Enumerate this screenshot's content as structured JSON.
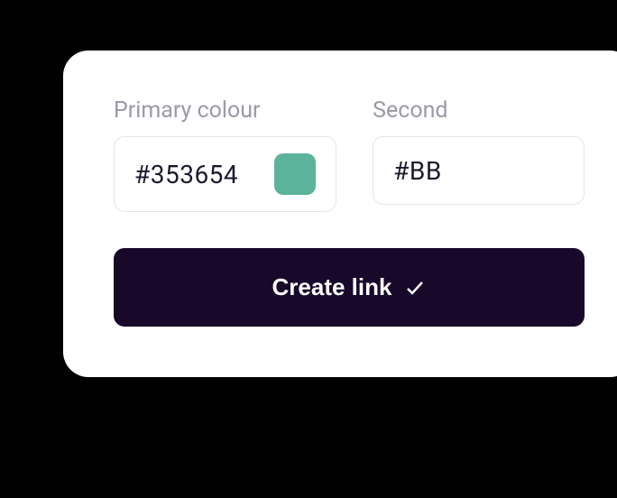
{
  "form": {
    "primary": {
      "label": "Primary colour",
      "value": "#353654",
      "swatch_color": "#5cb39c"
    },
    "secondary": {
      "label": "Second",
      "value": "#BB"
    },
    "create_button": {
      "label": "Create link",
      "bg_color": "#18082a"
    }
  }
}
